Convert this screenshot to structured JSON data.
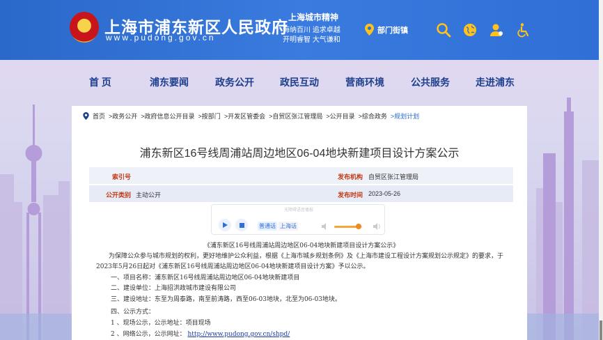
{
  "header": {
    "site_title": "上海市浦东新区人民政府",
    "site_url": "www.pudong.gov.cn",
    "spirit_title": "上海城市精神",
    "spirit_line1": "海纳百川  追求卓越",
    "spirit_line2": "开明睿智  大气谦和",
    "dept_label": "部门街镇"
  },
  "nav": [
    "首  页",
    "浦东要闻",
    "政务公开",
    "政民互动",
    "营商环境",
    "公共服务",
    "走进浦东"
  ],
  "breadcrumb": {
    "home": "首页",
    "items": [
      ">政务公开",
      ">政府信息公开目录",
      ">按部门",
      ">开发区管委会",
      ">自贸区张江管理局",
      ">公开目录",
      ">综合政务"
    ],
    "current": ">规划计划"
  },
  "article": {
    "title": "浦东新区16号线周浦站周边地区06-04地块新建项目设计方案公示",
    "index_label": "索引号",
    "index_value": "",
    "publisher_label": "发布机构",
    "publisher_value": "自贸区张江管理局",
    "category_label": "公开类别",
    "category_value": "主动公开",
    "date_label": "发布时间",
    "date_value": "2023-05-26"
  },
  "player": {
    "hint": "无障碍语音播报",
    "mandarin": "普通话",
    "shanghainese": "上海话"
  },
  "content": {
    "heading": "《浦东新区16号线周浦站周边地区06-04地块新建项目设计方案公示》",
    "para1": "为保障公众参与城市规划的权利，更好地维护公众利益，根据《上海市城乡规划条例》及《上海市建设工程设计方案规划公示规定》的要求，于2023年5月26日起对《浦东新区16号线周浦站周边地区06-04地块新建项目设计方案》予以公示。",
    "item1": "一、项目名称：浦东新区16号线周浦站周边地区06-04地块新建项目",
    "item2": "二、建设单位：上海招洪政城市建设有限公司",
    "item3": "三、建设地址：东至为周泰路，南至前涛路，西至06-03地块，北至为06-03地块。",
    "item4": "四、公示方式：",
    "item4_1": "1 、现场公示，公示地址：项目现场",
    "item4_2_prefix": "2 、网络公示，公示网址：",
    "item4_2_link": "http://www.pudong.gov.cn/shpd/"
  },
  "colors": {
    "header_blue": "#2f6fd6",
    "nav_text": "#1d3f8c",
    "label_red": "#c23a17",
    "accent_orange": "#f08a1c"
  }
}
